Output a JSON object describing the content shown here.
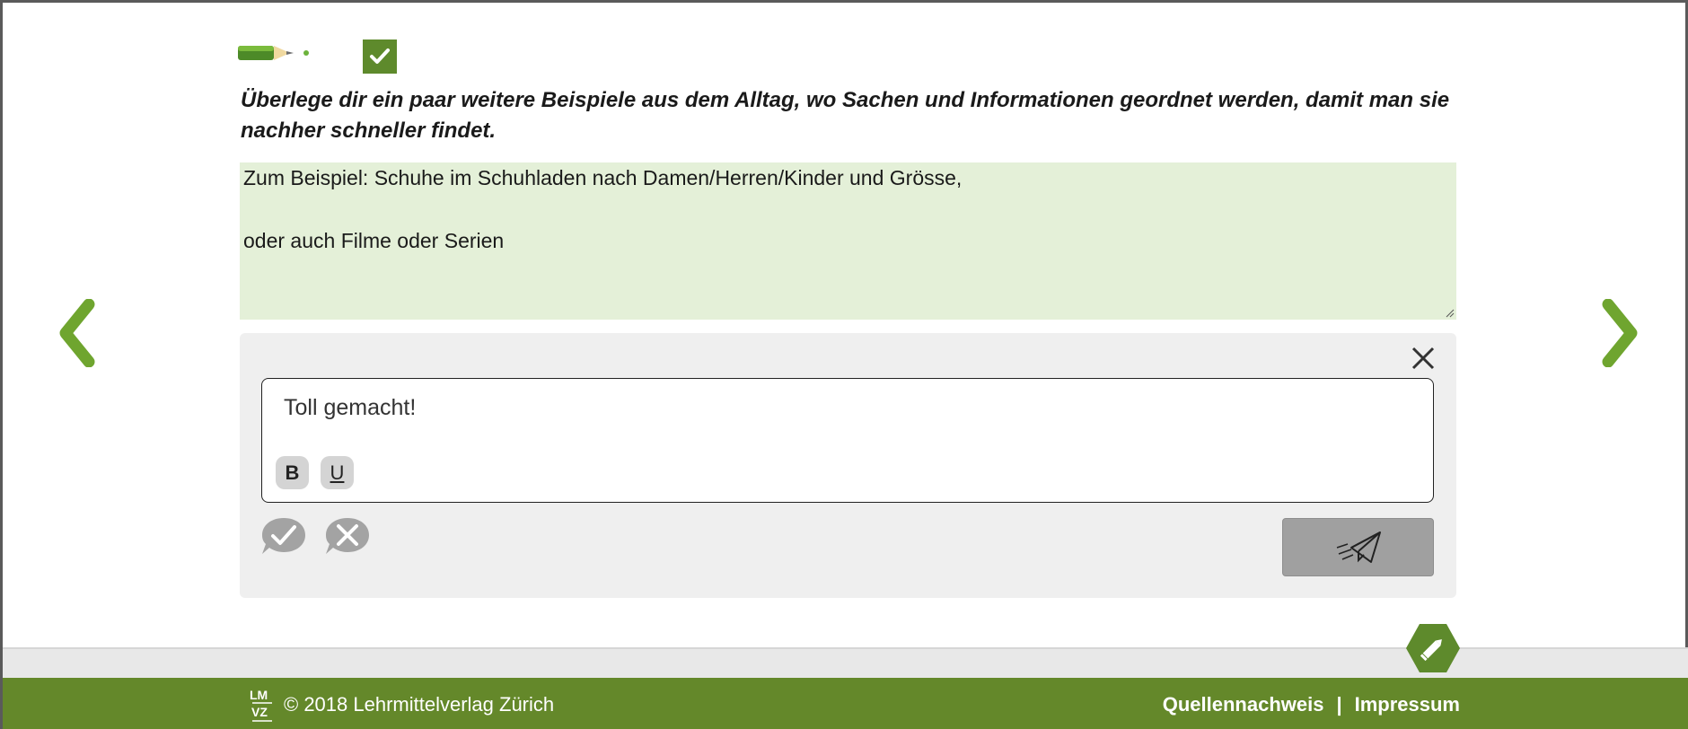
{
  "task": {
    "instruction": "Überlege dir ein paar weitere Beispiele aus dem Alltag, wo Sachen und Informationen geordnet werden, damit man sie nachher schneller findet."
  },
  "answer": {
    "line1": "Zum Beispiel: Schuhe im Schuhladen nach Damen/Herren/Kinder und Grösse,",
    "line2": "oder auch Filme oder Serien"
  },
  "feedback": {
    "text": "Toll gemacht!",
    "bold_label": "B",
    "underline_label": "U"
  },
  "footer": {
    "copyright": "© 2018 Lehrmittelverlag Zürich",
    "sources_link": "Quellennachweis",
    "separator": "|",
    "imprint_link": "Impressum"
  },
  "icons": {
    "pencil": "pencil-icon",
    "done": "checkmark-icon",
    "prev": "chevron-left-icon",
    "next": "chevron-right-icon",
    "close": "close-icon",
    "approve": "speech-bubble-check-icon",
    "reject": "speech-bubble-cross-icon",
    "send": "paper-plane-icon",
    "edit": "edit-pencil-icon",
    "logo": "lmvz-logo"
  },
  "colors": {
    "brand_green": "#64882a",
    "answer_bg": "#e4f0d8",
    "panel_bg": "#efefef",
    "nav_green": "#6fa52f"
  }
}
